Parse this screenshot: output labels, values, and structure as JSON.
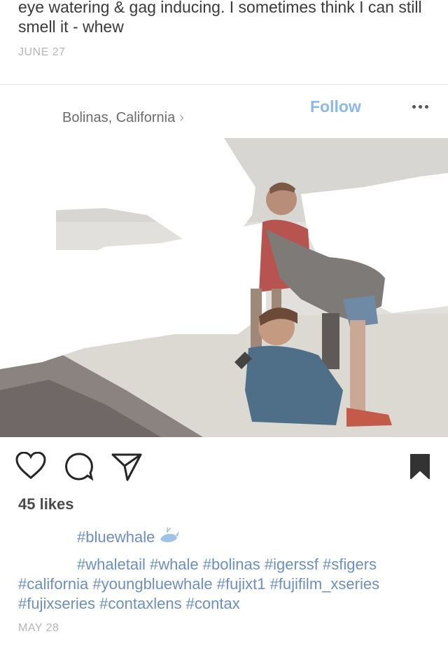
{
  "previous_post": {
    "caption": "eye watering & gag inducing. I sometimes think I can still smell it - whew",
    "date": "JUNE 27"
  },
  "post": {
    "location": "Bolinas, California",
    "location_chevron": "›",
    "follow_label": "Follow",
    "likes": "45 likes",
    "caption_line1": "#bluewhale",
    "caption_hashtags": "#whaletail #whale #bolinas #igerssf #sfigers #california #youngbluewhale #fujixt1 #fujifilm_xseries #fujixseries #contaxlens #contax",
    "date": "MAY 28"
  },
  "icons": {
    "heart": "heart-icon",
    "comment": "comment-icon",
    "share": "share-icon",
    "bookmark": "bookmark-icon",
    "more": "more-icon",
    "emoji": "whale-emoji-icon"
  },
  "colors": {
    "follow": "#8cb8e6",
    "hashtag": "#6b8fbf",
    "meta": "#b5b5b5"
  }
}
